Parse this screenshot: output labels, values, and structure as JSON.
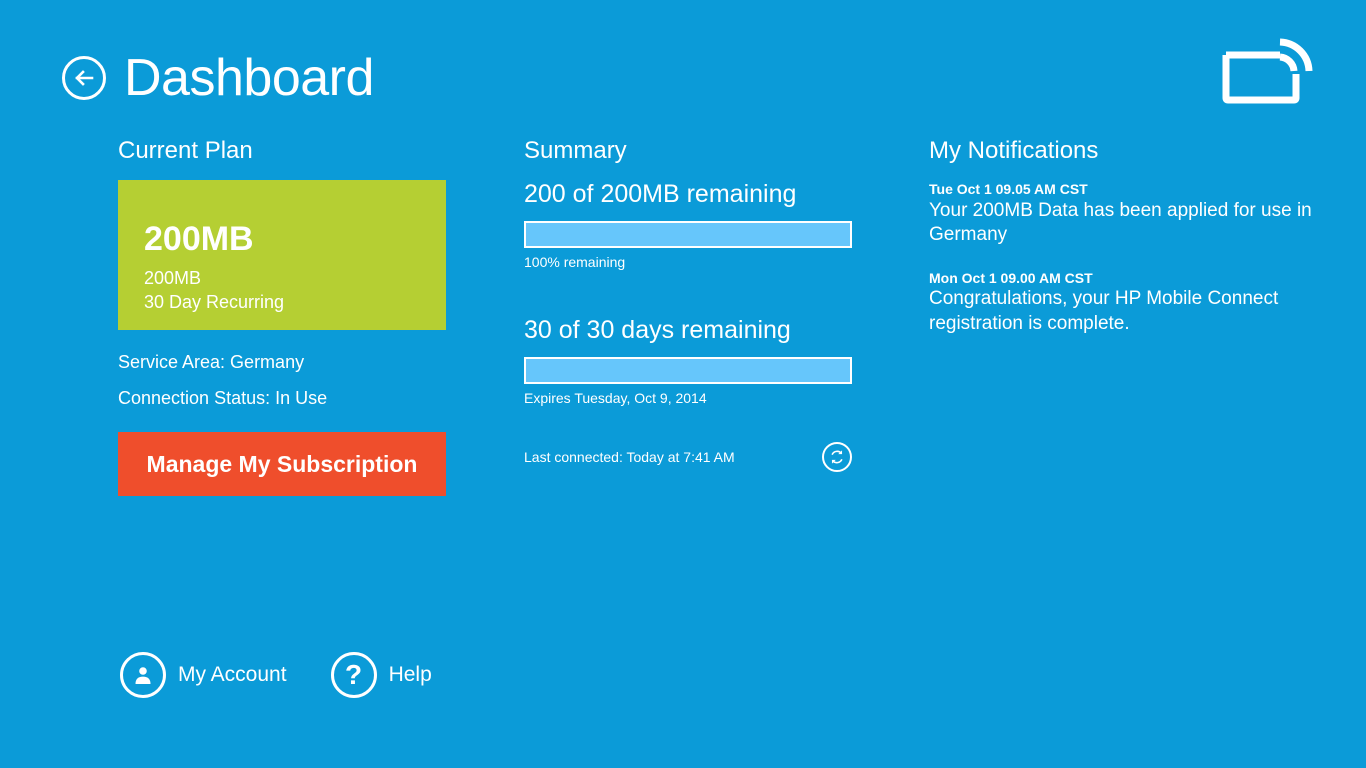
{
  "app": {
    "background_color": "#0b9bd8",
    "accent_green": "#b5cf33",
    "accent_orange": "#ef4e2c",
    "progress_fill_color": "#66c6fb"
  },
  "header": {
    "title": "Dashboard",
    "back_icon": "back-arrow-icon",
    "logo_icon": "mobile-connect-broadcast-logo"
  },
  "plan": {
    "heading": "Current Plan",
    "card": {
      "size": "200MB",
      "data_amount": "200MB",
      "term": "30 Day Recurring"
    },
    "service_area": "Service Area: Germany",
    "connection_status": "Connection Status: In Use",
    "manage_button": "Manage My Subscription"
  },
  "summary": {
    "heading": "Summary",
    "data": {
      "label": "200 of 200MB remaining",
      "percent": 100,
      "note": "100% remaining"
    },
    "days": {
      "label": "30 of 30 days remaining",
      "percent": 100,
      "note": "Expires Tuesday, Oct 9, 2014"
    },
    "last_connected": "Last connected: Today at 7:41 AM",
    "refresh_icon": "refresh-icon"
  },
  "notifications": {
    "heading": "My Notifications",
    "items": [
      {
        "time": "Tue Oct 1  09.05 AM CST",
        "text": "Your 200MB Data has been applied for use in Germany"
      },
      {
        "time": "Mon Oct 1  09.00 AM CST",
        "text": "Congratulations, your HP Mobile Connect registration is complete."
      }
    ]
  },
  "bottom_nav": {
    "items": [
      {
        "label": "My Account",
        "icon": "user-icon"
      },
      {
        "label": "Help",
        "icon": "question-mark-icon"
      }
    ]
  }
}
